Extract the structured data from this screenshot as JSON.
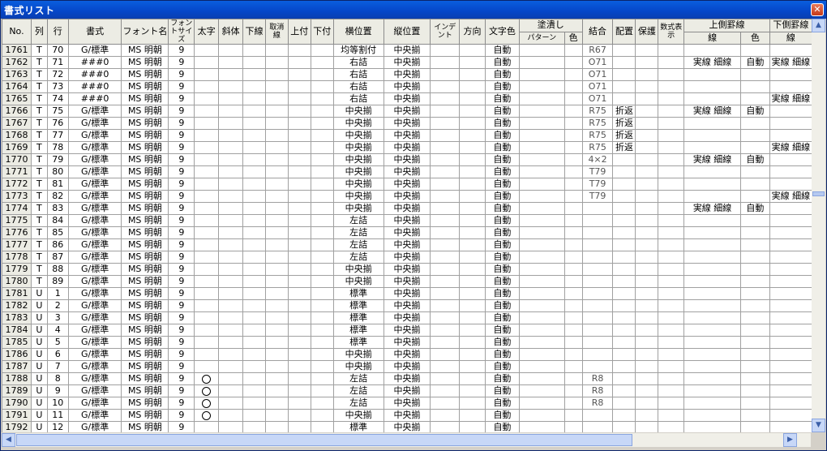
{
  "window": {
    "title": "書式リスト",
    "close_glyph": "✕"
  },
  "header": {
    "no": "No.",
    "col": "列",
    "row": "行",
    "format": "書式",
    "font_name": "フォント名",
    "font_size": "フォントサイズ",
    "bold": "太字",
    "italic": "斜体",
    "underline": "下線",
    "strike": "取消線",
    "superscript": "上付",
    "subscript": "下付",
    "h_align": "横位置",
    "v_align": "縦位置",
    "indent": "インデント",
    "direction": "方向",
    "text_color": "文字色",
    "fill": "塗潰し",
    "fill_pattern": "パターン",
    "fill_color": "色",
    "merge": "結合",
    "placement": "配置",
    "protect": "保護",
    "formula": "数式表示",
    "top_border": "上側罫線",
    "top_line": "線",
    "top_color": "色",
    "bottom_border": "下側罫線",
    "bottom_line": "線"
  },
  "rows": [
    {
      "no": "1761",
      "col": "T",
      "row": "70",
      "fmt": "G/標準",
      "font": "MS 明朝",
      "size": "9",
      "bold": "",
      "h": "均等割付",
      "v": "中央揃",
      "color": "自動",
      "merge": "R67",
      "place": "",
      "tline": "",
      "tcolor": "",
      "bline": ""
    },
    {
      "no": "1762",
      "col": "T",
      "row": "71",
      "fmt": "###0",
      "font": "MS 明朝",
      "size": "9",
      "bold": "",
      "h": "右詰",
      "v": "中央揃",
      "color": "自動",
      "merge": "O71",
      "place": "",
      "tline": "実線 細線",
      "tcolor": "自動",
      "bline": "実線 細線"
    },
    {
      "no": "1763",
      "col": "T",
      "row": "72",
      "fmt": "###0",
      "font": "MS 明朝",
      "size": "9",
      "bold": "",
      "h": "右詰",
      "v": "中央揃",
      "color": "自動",
      "merge": "O71",
      "place": "",
      "tline": "",
      "tcolor": "",
      "bline": ""
    },
    {
      "no": "1764",
      "col": "T",
      "row": "73",
      "fmt": "###0",
      "font": "MS 明朝",
      "size": "9",
      "bold": "",
      "h": "右詰",
      "v": "中央揃",
      "color": "自動",
      "merge": "O71",
      "place": "",
      "tline": "",
      "tcolor": "",
      "bline": ""
    },
    {
      "no": "1765",
      "col": "T",
      "row": "74",
      "fmt": "###0",
      "font": "MS 明朝",
      "size": "9",
      "bold": "",
      "h": "右詰",
      "v": "中央揃",
      "color": "自動",
      "merge": "O71",
      "place": "",
      "tline": "",
      "tcolor": "",
      "bline": "実線 細線"
    },
    {
      "no": "1766",
      "col": "T",
      "row": "75",
      "fmt": "G/標準",
      "font": "MS 明朝",
      "size": "9",
      "bold": "",
      "h": "中央揃",
      "v": "中央揃",
      "color": "自動",
      "merge": "R75",
      "place": "折返",
      "tline": "実線 細線",
      "tcolor": "自動",
      "bline": ""
    },
    {
      "no": "1767",
      "col": "T",
      "row": "76",
      "fmt": "G/標準",
      "font": "MS 明朝",
      "size": "9",
      "bold": "",
      "h": "中央揃",
      "v": "中央揃",
      "color": "自動",
      "merge": "R75",
      "place": "折返",
      "tline": "",
      "tcolor": "",
      "bline": ""
    },
    {
      "no": "1768",
      "col": "T",
      "row": "77",
      "fmt": "G/標準",
      "font": "MS 明朝",
      "size": "9",
      "bold": "",
      "h": "中央揃",
      "v": "中央揃",
      "color": "自動",
      "merge": "R75",
      "place": "折返",
      "tline": "",
      "tcolor": "",
      "bline": ""
    },
    {
      "no": "1769",
      "col": "T",
      "row": "78",
      "fmt": "G/標準",
      "font": "MS 明朝",
      "size": "9",
      "bold": "",
      "h": "中央揃",
      "v": "中央揃",
      "color": "自動",
      "merge": "R75",
      "place": "折返",
      "tline": "",
      "tcolor": "",
      "bline": "実線 細線"
    },
    {
      "no": "1770",
      "col": "T",
      "row": "79",
      "fmt": "G/標準",
      "font": "MS 明朝",
      "size": "9",
      "bold": "",
      "h": "中央揃",
      "v": "中央揃",
      "color": "自動",
      "merge": "4×2",
      "place": "",
      "tline": "実線 細線",
      "tcolor": "自動",
      "bline": ""
    },
    {
      "no": "1771",
      "col": "T",
      "row": "80",
      "fmt": "G/標準",
      "font": "MS 明朝",
      "size": "9",
      "bold": "",
      "h": "中央揃",
      "v": "中央揃",
      "color": "自動",
      "merge": "T79",
      "place": "",
      "tline": "",
      "tcolor": "",
      "bline": ""
    },
    {
      "no": "1772",
      "col": "T",
      "row": "81",
      "fmt": "G/標準",
      "font": "MS 明朝",
      "size": "9",
      "bold": "",
      "h": "中央揃",
      "v": "中央揃",
      "color": "自動",
      "merge": "T79",
      "place": "",
      "tline": "",
      "tcolor": "",
      "bline": ""
    },
    {
      "no": "1773",
      "col": "T",
      "row": "82",
      "fmt": "G/標準",
      "font": "MS 明朝",
      "size": "9",
      "bold": "",
      "h": "中央揃",
      "v": "中央揃",
      "color": "自動",
      "merge": "T79",
      "place": "",
      "tline": "",
      "tcolor": "",
      "bline": "実線 細線"
    },
    {
      "no": "1774",
      "col": "T",
      "row": "83",
      "fmt": "G/標準",
      "font": "MS 明朝",
      "size": "9",
      "bold": "",
      "h": "中央揃",
      "v": "中央揃",
      "color": "自動",
      "merge": "",
      "place": "",
      "tline": "実線 細線",
      "tcolor": "自動",
      "bline": ""
    },
    {
      "no": "1775",
      "col": "T",
      "row": "84",
      "fmt": "G/標準",
      "font": "MS 明朝",
      "size": "9",
      "bold": "",
      "h": "左詰",
      "v": "中央揃",
      "color": "自動",
      "merge": "",
      "place": "",
      "tline": "",
      "tcolor": "",
      "bline": ""
    },
    {
      "no": "1776",
      "col": "T",
      "row": "85",
      "fmt": "G/標準",
      "font": "MS 明朝",
      "size": "9",
      "bold": "",
      "h": "左詰",
      "v": "中央揃",
      "color": "自動",
      "merge": "",
      "place": "",
      "tline": "",
      "tcolor": "",
      "bline": ""
    },
    {
      "no": "1777",
      "col": "T",
      "row": "86",
      "fmt": "G/標準",
      "font": "MS 明朝",
      "size": "9",
      "bold": "",
      "h": "左詰",
      "v": "中央揃",
      "color": "自動",
      "merge": "",
      "place": "",
      "tline": "",
      "tcolor": "",
      "bline": ""
    },
    {
      "no": "1778",
      "col": "T",
      "row": "87",
      "fmt": "G/標準",
      "font": "MS 明朝",
      "size": "9",
      "bold": "",
      "h": "左詰",
      "v": "中央揃",
      "color": "自動",
      "merge": "",
      "place": "",
      "tline": "",
      "tcolor": "",
      "bline": ""
    },
    {
      "no": "1779",
      "col": "T",
      "row": "88",
      "fmt": "G/標準",
      "font": "MS 明朝",
      "size": "9",
      "bold": "",
      "h": "中央揃",
      "v": "中央揃",
      "color": "自動",
      "merge": "",
      "place": "",
      "tline": "",
      "tcolor": "",
      "bline": ""
    },
    {
      "no": "1780",
      "col": "T",
      "row": "89",
      "fmt": "G/標準",
      "font": "MS 明朝",
      "size": "9",
      "bold": "",
      "h": "中央揃",
      "v": "中央揃",
      "color": "自動",
      "merge": "",
      "place": "",
      "tline": "",
      "tcolor": "",
      "bline": ""
    },
    {
      "no": "1781",
      "col": "U",
      "row": "1",
      "fmt": "G/標準",
      "font": "MS 明朝",
      "size": "9",
      "bold": "",
      "h": "標準",
      "v": "中央揃",
      "color": "自動",
      "merge": "",
      "place": "",
      "tline": "",
      "tcolor": "",
      "bline": ""
    },
    {
      "no": "1782",
      "col": "U",
      "row": "2",
      "fmt": "G/標準",
      "font": "MS 明朝",
      "size": "9",
      "bold": "",
      "h": "標準",
      "v": "中央揃",
      "color": "自動",
      "merge": "",
      "place": "",
      "tline": "",
      "tcolor": "",
      "bline": ""
    },
    {
      "no": "1783",
      "col": "U",
      "row": "3",
      "fmt": "G/標準",
      "font": "MS 明朝",
      "size": "9",
      "bold": "",
      "h": "標準",
      "v": "中央揃",
      "color": "自動",
      "merge": "",
      "place": "",
      "tline": "",
      "tcolor": "",
      "bline": ""
    },
    {
      "no": "1784",
      "col": "U",
      "row": "4",
      "fmt": "G/標準",
      "font": "MS 明朝",
      "size": "9",
      "bold": "",
      "h": "標準",
      "v": "中央揃",
      "color": "自動",
      "merge": "",
      "place": "",
      "tline": "",
      "tcolor": "",
      "bline": ""
    },
    {
      "no": "1785",
      "col": "U",
      "row": "5",
      "fmt": "G/標準",
      "font": "MS 明朝",
      "size": "9",
      "bold": "",
      "h": "標準",
      "v": "中央揃",
      "color": "自動",
      "merge": "",
      "place": "",
      "tline": "",
      "tcolor": "",
      "bline": ""
    },
    {
      "no": "1786",
      "col": "U",
      "row": "6",
      "fmt": "G/標準",
      "font": "MS 明朝",
      "size": "9",
      "bold": "",
      "h": "中央揃",
      "v": "中央揃",
      "color": "自動",
      "merge": "",
      "place": "",
      "tline": "",
      "tcolor": "",
      "bline": ""
    },
    {
      "no": "1787",
      "col": "U",
      "row": "7",
      "fmt": "G/標準",
      "font": "MS 明朝",
      "size": "9",
      "bold": "",
      "h": "中央揃",
      "v": "中央揃",
      "color": "自動",
      "merge": "",
      "place": "",
      "tline": "",
      "tcolor": "",
      "bline": ""
    },
    {
      "no": "1788",
      "col": "U",
      "row": "8",
      "fmt": "G/標準",
      "font": "MS 明朝",
      "size": "9",
      "bold": "○",
      "h": "左詰",
      "v": "中央揃",
      "color": "自動",
      "merge": "R8",
      "place": "",
      "tline": "",
      "tcolor": "",
      "bline": ""
    },
    {
      "no": "1789",
      "col": "U",
      "row": "9",
      "fmt": "G/標準",
      "font": "MS 明朝",
      "size": "9",
      "bold": "○",
      "h": "左詰",
      "v": "中央揃",
      "color": "自動",
      "merge": "R8",
      "place": "",
      "tline": "",
      "tcolor": "",
      "bline": ""
    },
    {
      "no": "1790",
      "col": "U",
      "row": "10",
      "fmt": "G/標準",
      "font": "MS 明朝",
      "size": "9",
      "bold": "○",
      "h": "左詰",
      "v": "中央揃",
      "color": "自動",
      "merge": "R8",
      "place": "",
      "tline": "",
      "tcolor": "",
      "bline": ""
    },
    {
      "no": "1791",
      "col": "U",
      "row": "11",
      "fmt": "G/標準",
      "font": "MS 明朝",
      "size": "9",
      "bold": "○",
      "h": "中央揃",
      "v": "中央揃",
      "color": "自動",
      "merge": "",
      "place": "",
      "tline": "",
      "tcolor": "",
      "bline": ""
    },
    {
      "no": "1792",
      "col": "U",
      "row": "12",
      "fmt": "G/標準",
      "font": "MS 明朝",
      "size": "9",
      "bold": "",
      "h": "標準",
      "v": "中央揃",
      "color": "自動",
      "merge": "",
      "place": "",
      "tline": "",
      "tcolor": "",
      "bline": ""
    }
  ],
  "scrollbars": {
    "up_glyph": "▲",
    "down_glyph": "▼",
    "left_glyph": "◀",
    "right_glyph": "▶"
  }
}
